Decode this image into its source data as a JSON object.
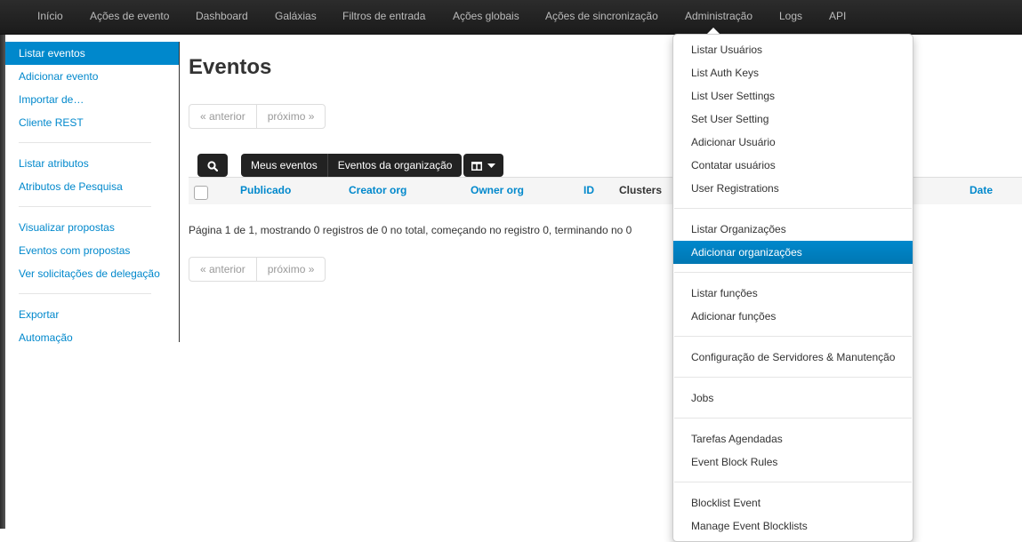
{
  "navbar": {
    "items": [
      "Início",
      "Ações de evento",
      "Dashboard",
      "Galáxias",
      "Filtros de entrada",
      "Ações globais",
      "Ações de sincronização",
      "Administração",
      "Logs",
      "API"
    ]
  },
  "sidebar": {
    "items": [
      "Listar eventos",
      "Adicionar evento",
      "Importar de…",
      "Cliente REST",
      "Listar atributos",
      "Atributos de Pesquisa",
      "Visualizar propostas",
      "Eventos com propostas",
      "Ver solicitações de delegação",
      "Exportar",
      "Automação"
    ]
  },
  "main": {
    "title": "Eventos",
    "pagination": {
      "prev": "« anterior",
      "next": "próximo »"
    },
    "filters": {
      "my_events": "Meus eventos",
      "org_events": "Eventos da organização"
    },
    "columns": [
      "Publicado",
      "Creator org",
      "Owner org",
      "ID",
      "Clusters",
      "Date"
    ],
    "summary": "Página 1 de 1, mostrando 0 registros de 0 no total, começando no registro 0, terminando no 0"
  },
  "admin_menu": {
    "items": [
      "Listar Usuários",
      "List Auth Keys",
      "List User Settings",
      "Set User Setting",
      "Adicionar Usuário",
      "Contatar usuários",
      "User Registrations",
      "Listar Organizações",
      "Adicionar organizações",
      "Listar funções",
      "Adicionar funções",
      "Configuração de Servidores & Manutenção",
      "Jobs",
      "Tarefas Agendadas",
      "Event Block Rules",
      "Blocklist Event",
      "Manage Event Blocklists"
    ]
  },
  "colors": {
    "accent": "#0088cc",
    "navbar": "#1b1b1b"
  }
}
